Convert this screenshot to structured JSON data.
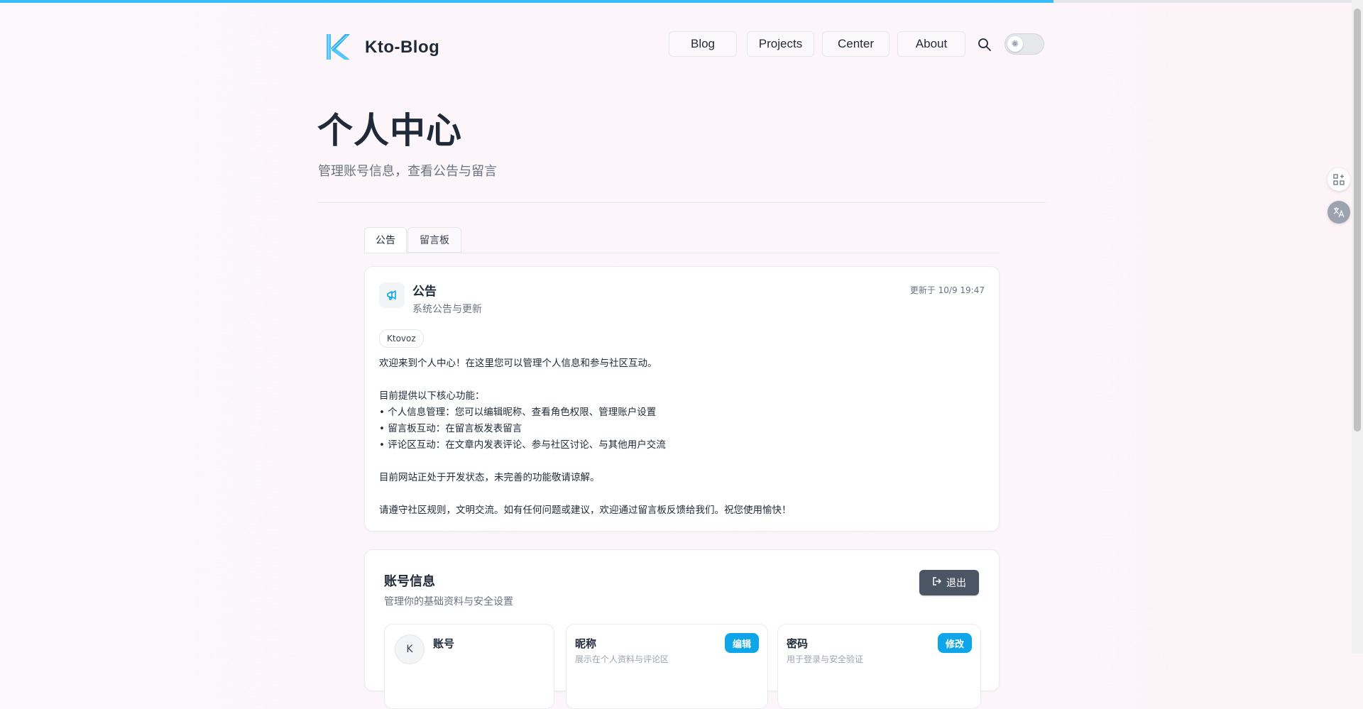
{
  "site": {
    "brand": "Kto-Blog"
  },
  "nav": [
    {
      "label": "Blog"
    },
    {
      "label": "Projects"
    },
    {
      "label": "Center"
    },
    {
      "label": "About"
    }
  ],
  "page": {
    "title": "个人中心",
    "subtitle": "管理账号信息，查看公告与留言"
  },
  "tabs": [
    {
      "label": "公告",
      "active": true
    },
    {
      "label": "留言板",
      "active": false
    }
  ],
  "announcement": {
    "title": "公告",
    "subtitle": "系统公告与更新",
    "updated": "更新于 10/9 19:47",
    "author": "Ktovoz",
    "lines": [
      "欢迎来到个人中心！在这里您可以管理个人信息和参与社区互动。",
      "",
      "目前提供以下核心功能：",
      "• 个人信息管理：您可以编辑昵称、查看角色权限、管理账户设置",
      "• 留言板互动：在留言板发表留言",
      "• 评论区互动：在文章内发表评论、参与社区讨论、与其他用户交流",
      "",
      "目前网站正处于开发状态，未完善的功能敬请谅解。",
      "",
      "请遵守社区规则，文明交流。如有任何问题或建议，欢迎通过留言板反馈给我们。祝您使用愉快！"
    ]
  },
  "account": {
    "title": "账号信息",
    "subtitle": "管理你的基础资料与安全设置",
    "logout_label": "退出",
    "cards": [
      {
        "title": "账号",
        "avatar": "K",
        "desc": "",
        "button": ""
      },
      {
        "title": "昵称",
        "avatar": "",
        "desc": "展示在个人资料与评论区",
        "button": "编辑"
      },
      {
        "title": "密码",
        "avatar": "",
        "desc": "用于登录与安全验证",
        "button": "修改"
      }
    ]
  },
  "colors": {
    "accent": "#0ea5e9",
    "top_bar": "#38bdf8",
    "logout_bg": "#4b5563"
  },
  "icons": {
    "theme_toggle": "sun-icon",
    "search": "search-icon",
    "announcement": "megaphone-icon",
    "logout": "logout-icon",
    "side_apps": "apps-add-icon",
    "side_translate": "translate-icon"
  }
}
